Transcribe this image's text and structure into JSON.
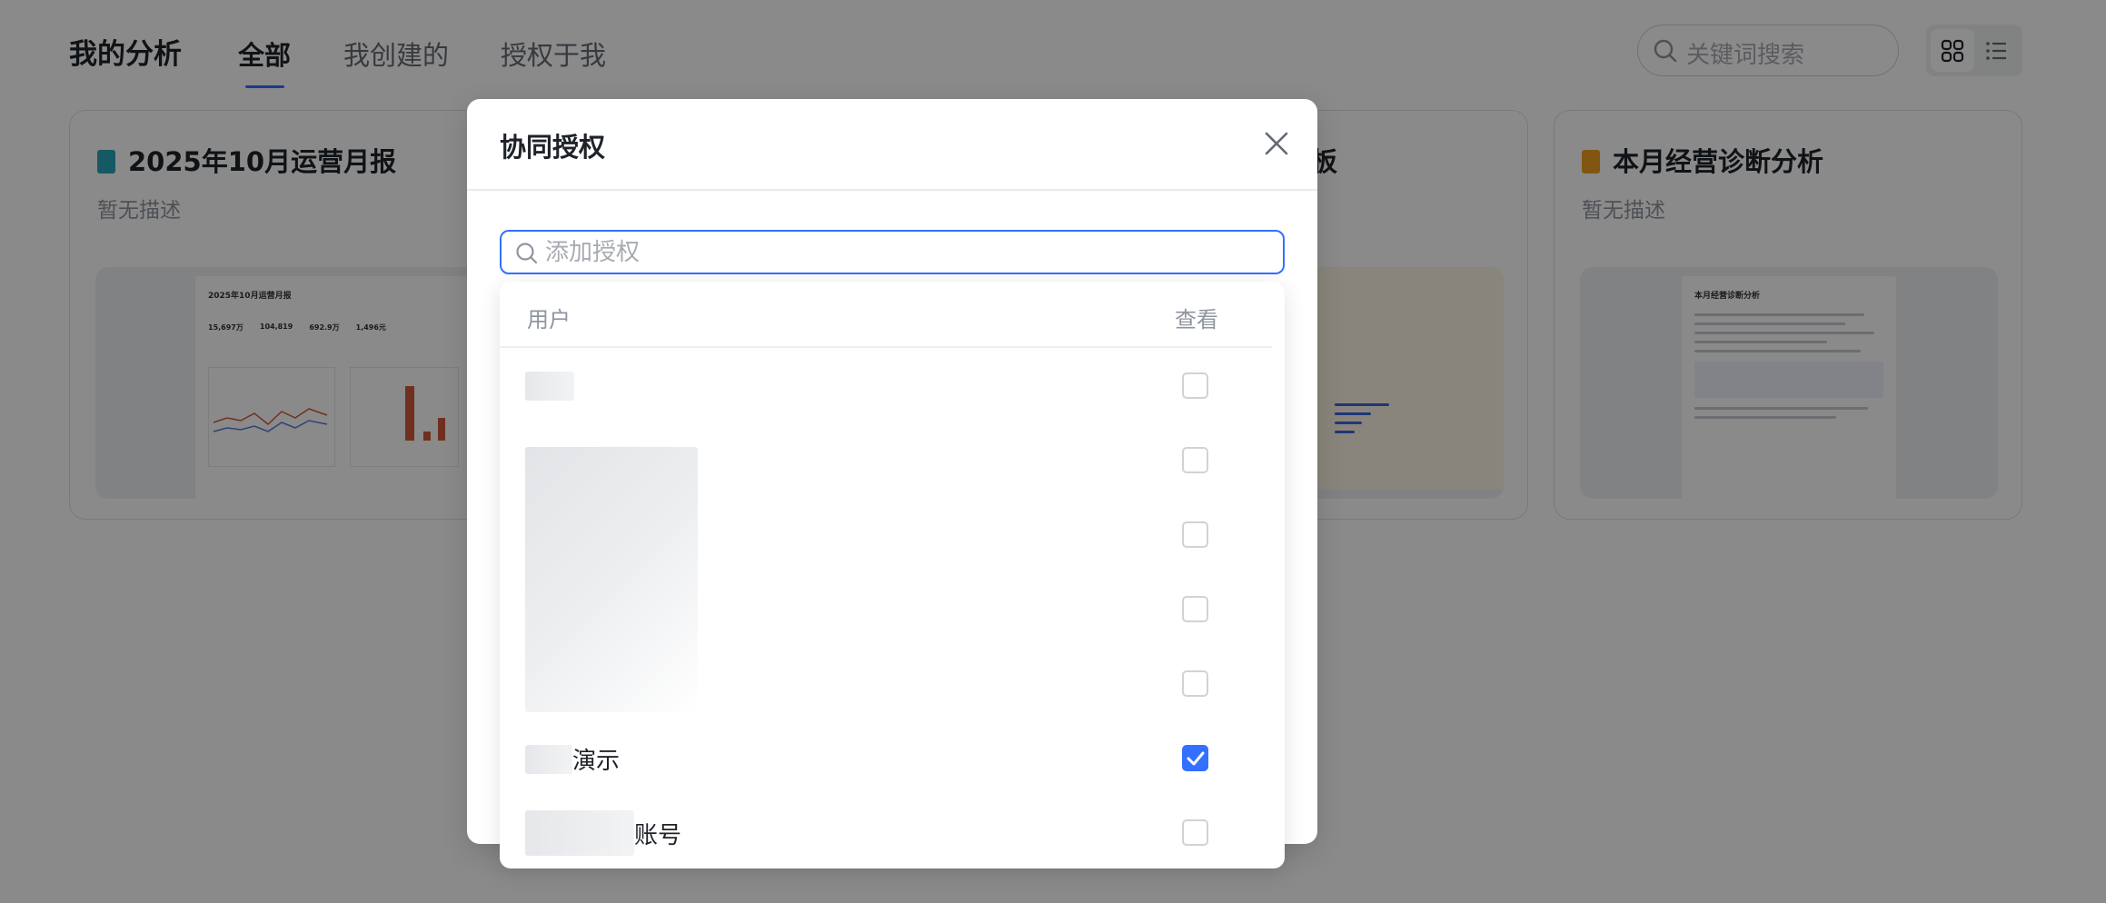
{
  "header": {
    "title": "我的分析",
    "tabs": [
      {
        "label": "全部",
        "active": true
      },
      {
        "label": "我创建的",
        "active": false
      },
      {
        "label": "授权于我",
        "active": false
      }
    ],
    "search_placeholder": "关键词搜索",
    "view_modes": {
      "grid_icon": "grid-icon",
      "list_icon": "list-icon",
      "active": "grid"
    }
  },
  "cards": [
    {
      "title": "2025年10月运营月报",
      "desc": "暂无描述",
      "icon_color": "#26a4b8",
      "preview": {
        "title": "2025年10月运营月报",
        "kpis": [
          "15,697万",
          "104,819",
          "692.9万",
          "1,496元"
        ]
      }
    },
    {
      "title": "板",
      "desc": "",
      "icon_color": "#f0a020",
      "preview": {}
    },
    {
      "title": "本月经营诊断分析",
      "desc": "暂无描述",
      "icon_color": "#f0a020",
      "preview": {
        "title": "本月经营诊断分析"
      }
    }
  ],
  "modal": {
    "title": "协同授权",
    "close_icon": "close-icon",
    "input_placeholder": "添加授权",
    "input_value": ""
  },
  "dropdown": {
    "col_user": "用户",
    "col_view": "查看",
    "rows": [
      {
        "name": "",
        "checked": false
      },
      {
        "name": "",
        "checked": false
      },
      {
        "name": "",
        "checked": false
      },
      {
        "name": "",
        "checked": false
      },
      {
        "name": "",
        "checked": false
      },
      {
        "name": "演示",
        "checked": true
      },
      {
        "name": "账号",
        "checked": false
      }
    ]
  },
  "colors": {
    "accent": "#3370ff",
    "text": "#1f2329",
    "muted": "#8f959e"
  }
}
